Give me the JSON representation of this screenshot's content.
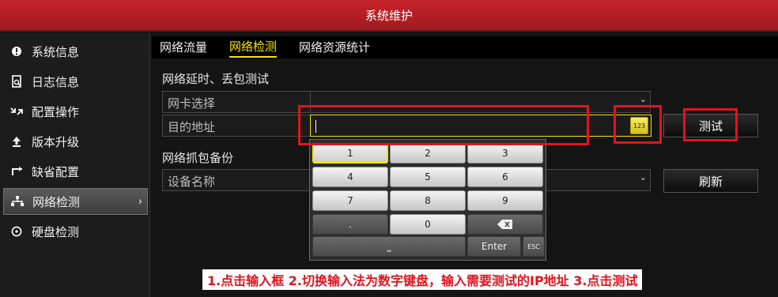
{
  "window": {
    "title": "系统维护"
  },
  "sidebar": {
    "items": [
      {
        "label": "系统信息",
        "icon": "info-icon"
      },
      {
        "label": "日志信息",
        "icon": "log-icon"
      },
      {
        "label": "配置操作",
        "icon": "config-icon"
      },
      {
        "label": "版本升级",
        "icon": "upgrade-icon"
      },
      {
        "label": "缺省配置",
        "icon": "default-config-icon"
      },
      {
        "label": "网络检测",
        "icon": "network-icon",
        "active": true
      },
      {
        "label": "硬盘检测",
        "icon": "disk-icon"
      }
    ],
    "active_chevron": "›"
  },
  "tabs": [
    {
      "label": "网络流量"
    },
    {
      "label": "网络检测",
      "active": true
    },
    {
      "label": "网络资源统计"
    }
  ],
  "latency": {
    "section_title": "网络延时、丢包测试",
    "nic_label": "网卡选择",
    "nic_value": "",
    "dest_label": "目的地址",
    "dest_value": "",
    "ime_label": "123",
    "test_button": "测试"
  },
  "capture": {
    "section_title": "网络抓包备份",
    "device_label": "设备名称",
    "device_value": "",
    "refresh_button": "刷新"
  },
  "keypad": {
    "keys": [
      "1",
      "2",
      "3",
      "4",
      "5",
      "6",
      "7",
      "8",
      "9",
      ".",
      "0"
    ],
    "backspace_icon": "backspace-icon",
    "space_label": "⎵",
    "enter_label": "Enter",
    "esc_label": "ESC",
    "selected_key": "1"
  },
  "colors": {
    "title_red": "#b01e24",
    "accent_yellow": "#f5e400",
    "annotation_red": "#e0141e"
  },
  "annotation": "1.点击输入框   2.切换输入法为数字键盘，输入需要测试的IP地址   3.点击测试"
}
